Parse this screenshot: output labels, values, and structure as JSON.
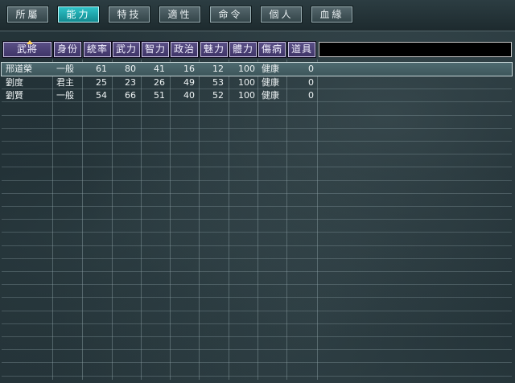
{
  "tabs": [
    {
      "label": "所屬",
      "active": false
    },
    {
      "label": "能力",
      "active": true
    },
    {
      "label": "特技",
      "active": false
    },
    {
      "label": "適性",
      "active": false
    },
    {
      "label": "命令",
      "active": false
    },
    {
      "label": "個人",
      "active": false
    },
    {
      "label": "血緣",
      "active": false
    }
  ],
  "table": {
    "sorted_column": "武將",
    "headers": [
      "武將",
      "身份",
      "統率",
      "武力",
      "智力",
      "政治",
      "魅力",
      "體力",
      "傷病",
      "道具"
    ],
    "rows": [
      {
        "name": "邢道榮",
        "status": "一般",
        "lead": "61",
        "war": "80",
        "int": "41",
        "pol": "16",
        "chr": "12",
        "hp": "100",
        "health": "健康",
        "items": "0",
        "selected": true
      },
      {
        "name": "劉度",
        "status": "君主",
        "lead": "25",
        "war": "23",
        "int": "26",
        "pol": "49",
        "chr": "53",
        "hp": "100",
        "health": "健康",
        "items": "0",
        "selected": false
      },
      {
        "name": "劉賢",
        "status": "一般",
        "lead": "54",
        "war": "66",
        "int": "51",
        "pol": "40",
        "chr": "52",
        "hp": "100",
        "health": "健康",
        "items": "0",
        "selected": false
      }
    ]
  }
}
